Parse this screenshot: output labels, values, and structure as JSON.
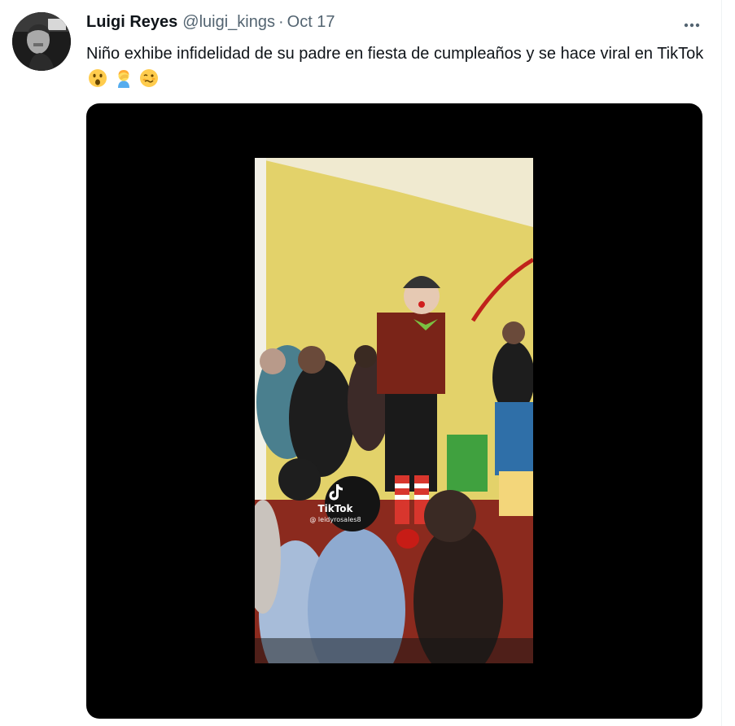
{
  "author": {
    "name": "Luigi Reyes",
    "handle": "@luigi_kings",
    "separator": "·",
    "date": "Oct 17"
  },
  "tweet": {
    "text": "Niño exhibe infidelidad de su padre en fiesta de cumpleaños y se hace viral en TikTok",
    "emojis": [
      "astonished-face-emoji",
      "person-facepalming-emoji",
      "woozy-face-emoji"
    ]
  },
  "media": {
    "watermark_brand": "TikTok",
    "watermark_handle": "@ leidyrosales8"
  },
  "icons": {
    "more": "more-options-icon"
  },
  "colors": {
    "text_primary": "#0f1419",
    "text_secondary": "#536471",
    "media_background": "#000000"
  }
}
